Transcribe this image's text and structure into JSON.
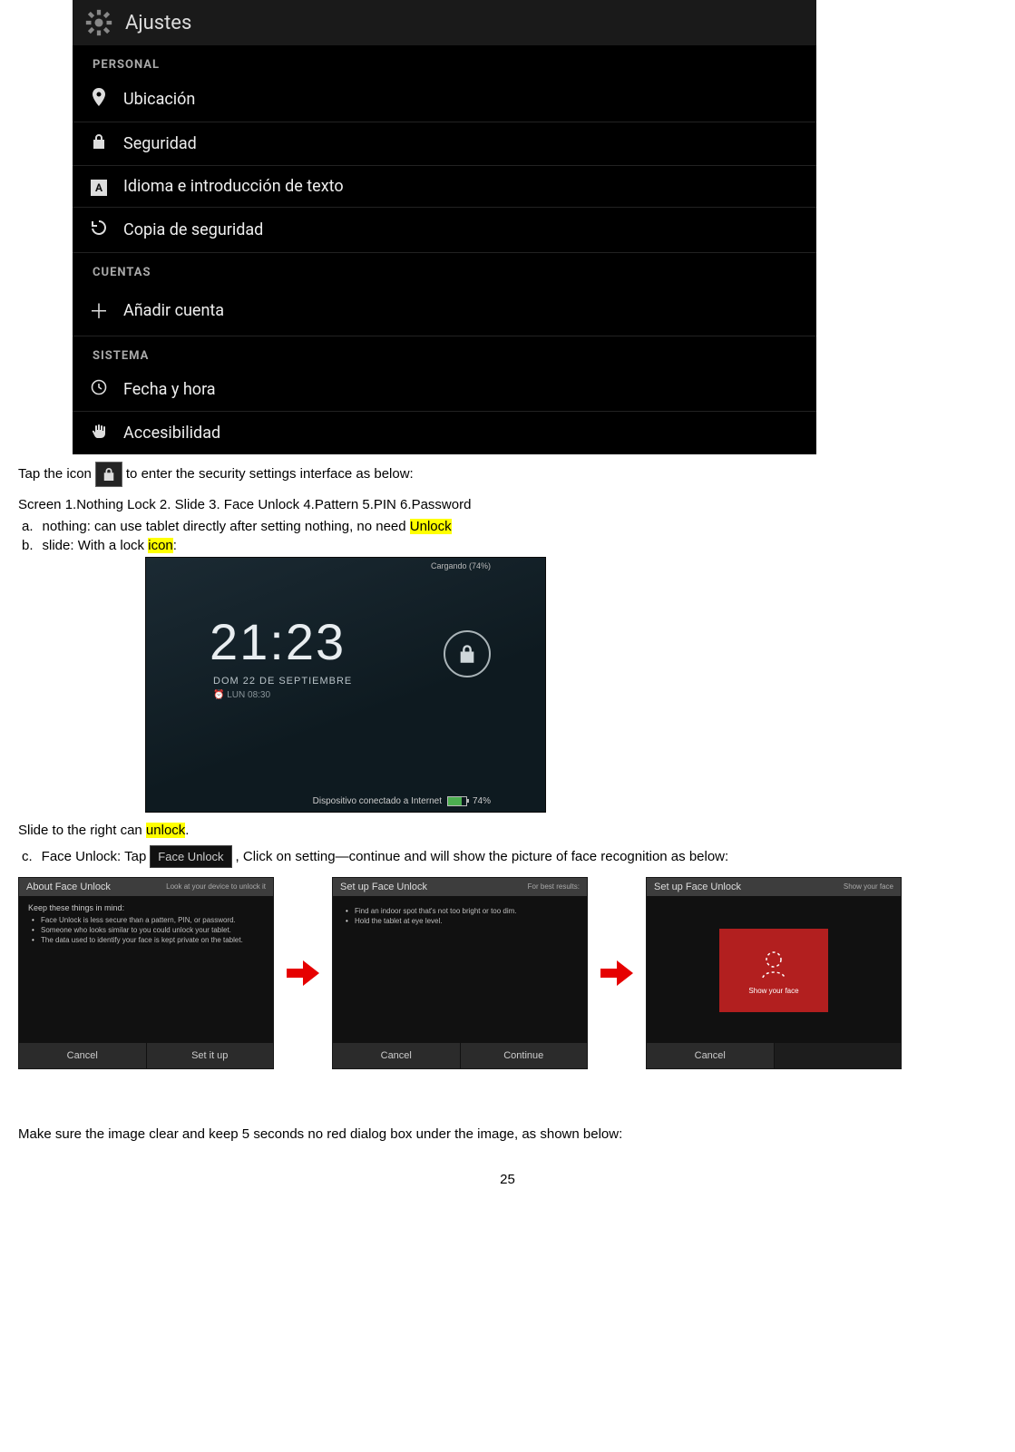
{
  "page_number": "25",
  "settings_shot": {
    "title": "Ajustes",
    "cat_personal": "PERSONAL",
    "items_personal": [
      "Ubicación",
      "Seguridad",
      "Idioma e introducción de texto",
      "Copia de seguridad"
    ],
    "cat_cuentas": "CUENTAS",
    "add_account": "Añadir cuenta",
    "cat_sistema": "SISTEMA",
    "items_sistema": [
      "Fecha y hora",
      "Accesibilidad"
    ]
  },
  "p1": {
    "pre": "Tap the icon ",
    "post": " to enter the security settings interface as below:"
  },
  "p2": "Screen 1.Nothing Lock 2. Slide 3. Face Unlock 4.Pattern 5.PIN 6.Password",
  "list": {
    "a_pre": "a.",
    "a_mid": "nothing: can use tablet directly after setting nothing, no need ",
    "a_hl": "Unlock",
    "b_pre": "b.",
    "b_mid": "slide: With a lock ",
    "b_hl": "icon",
    "b_post": ":",
    "c_pre": "c.",
    "c_mid": "Face Unlock: Tap ",
    "c_btn": "Face Unlock",
    "c_post": ", Click on setting—continue and will show the picture of face recognition as below:"
  },
  "slide_line_pre": "Slide to the right can ",
  "slide_hl": "unlock",
  "slide_line_post": ".",
  "lockscreen": {
    "status": "Cargando (74%)",
    "time": "21:23",
    "date": "DOM 22 DE SEPTIEMBRE",
    "alarm": "⏰ LUN 08:30",
    "footer_text": "Dispositivo conectado a Internet",
    "batt": "74%"
  },
  "panels": {
    "p1": {
      "title": "About Face Unlock",
      "subtitle": "Look at your device to unlock it",
      "body_head": "Keep these things in mind:",
      "bullets": [
        "Face Unlock is less secure than a pattern, PIN, or password.",
        "Someone who looks similar to you could unlock your tablet.",
        "The data used to identify your face is kept private on the tablet."
      ],
      "foot_left": "Cancel",
      "foot_right": "Set it up"
    },
    "p2": {
      "title": "Set up Face Unlock",
      "subtitle": "For best results:",
      "bullets": [
        "Find an indoor spot that's not too bright or too dim.",
        "Hold the tablet at eye level."
      ],
      "foot_left": "Cancel",
      "foot_right": "Continue"
    },
    "p3": {
      "title": "Set up Face Unlock",
      "red_caption": "Show your face",
      "foot_left": "Cancel"
    }
  },
  "final_line": "Make sure the image clear and keep 5 seconds no red dialog box under the image, as shown below:"
}
